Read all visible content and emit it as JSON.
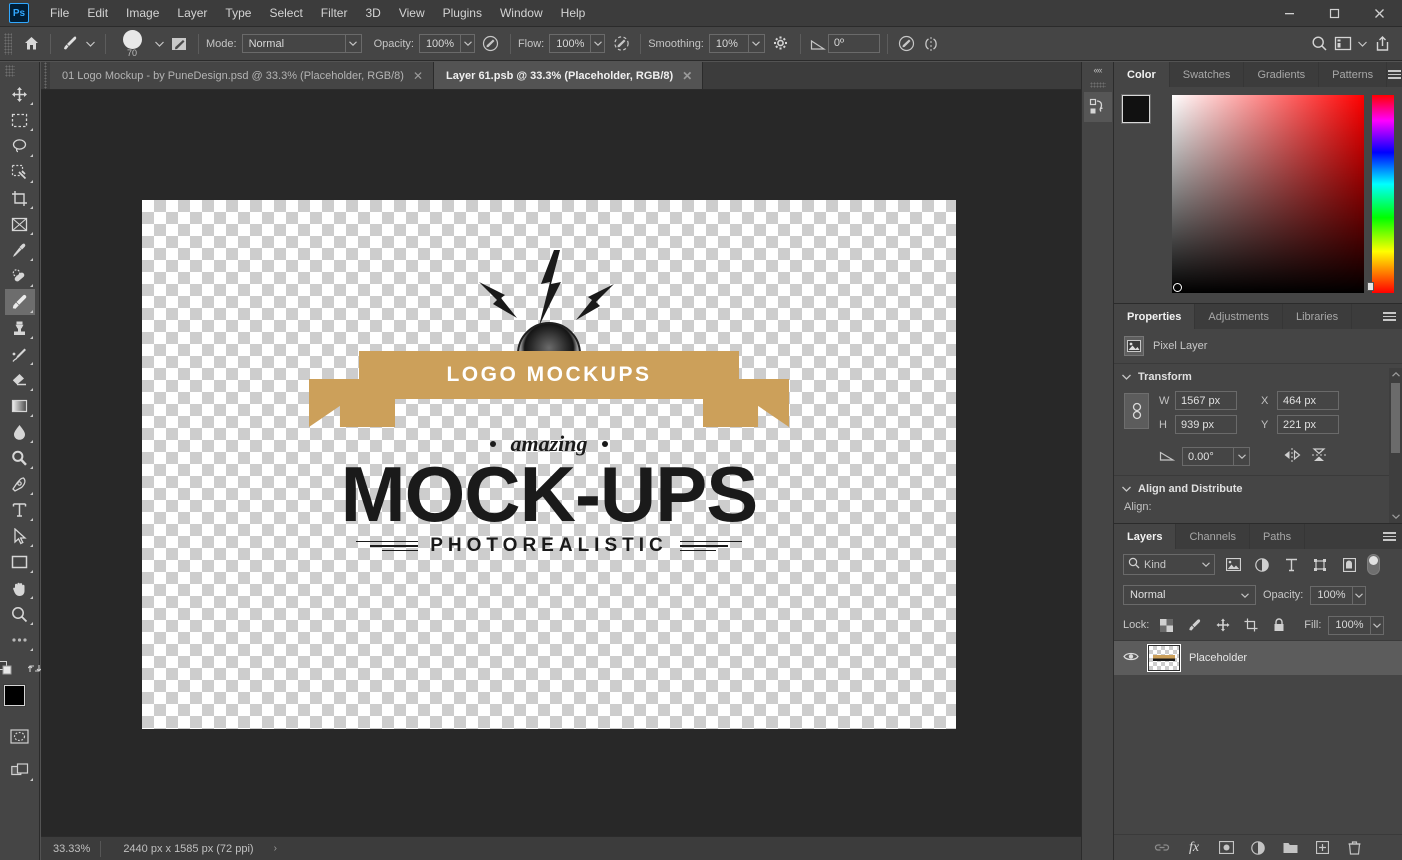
{
  "app": {
    "name": "Ps",
    "logo_label": "Ps"
  },
  "menu": {
    "items": [
      "File",
      "Edit",
      "Image",
      "Layer",
      "Type",
      "Select",
      "Filter",
      "3D",
      "View",
      "Plugins",
      "Window",
      "Help"
    ]
  },
  "window_controls": {
    "minimize": "–",
    "maximize": "□",
    "close": "✕"
  },
  "options_bar": {
    "home_icon": "home-icon",
    "brush_icon": "brush-icon",
    "brush_size": "70",
    "brush_settings_icon": "brush-settings-icon",
    "mode_label": "Mode:",
    "mode_value": "Normal",
    "opacity_label": "Opacity:",
    "opacity_value": "100%",
    "opacity_pressure_icon": "pressure-opacity-icon",
    "flow_label": "Flow:",
    "flow_value": "100%",
    "airbrush_icon": "airbrush-icon",
    "smoothing_label": "Smoothing:",
    "smoothing_value": "10%",
    "smoothing_options_icon": "gear-icon",
    "angle_label": "angle-icon",
    "angle_value": "0º",
    "pressure_size_icon": "pressure-size-icon",
    "symmetry_icon": "symmetry-icon",
    "search_icon": "search-icon",
    "workspace_icon": "workspace-icon",
    "workspace_arrow": "⌄",
    "share_icon": "share-icon"
  },
  "tabs": [
    {
      "title": "01 Logo Mockup - by PuneDesign.psd @ 33.3% (Placeholder, RGB/8)",
      "active": false,
      "close": "✕"
    },
    {
      "title": "Layer 61.psb @ 33.3% (Placeholder, RGB/8)",
      "active": true,
      "close": "✕"
    }
  ],
  "toolbar": {
    "tools": [
      {
        "name": "move-tool",
        "active": false
      },
      {
        "name": "marquee-tool",
        "active": false
      },
      {
        "name": "lasso-tool",
        "active": false
      },
      {
        "name": "quick-selection-tool",
        "active": false
      },
      {
        "name": "crop-tool",
        "active": false
      },
      {
        "name": "frame-tool",
        "active": false
      },
      {
        "name": "eyedropper-tool",
        "active": false
      },
      {
        "name": "healing-brush-tool",
        "active": false
      },
      {
        "name": "brush-tool",
        "active": true
      },
      {
        "name": "clone-stamp-tool",
        "active": false
      },
      {
        "name": "history-brush-tool",
        "active": false
      },
      {
        "name": "eraser-tool",
        "active": false
      },
      {
        "name": "gradient-tool",
        "active": false
      },
      {
        "name": "blur-tool",
        "active": false
      },
      {
        "name": "dodge-tool",
        "active": false
      },
      {
        "name": "pen-tool",
        "active": false
      },
      {
        "name": "type-tool",
        "active": false
      },
      {
        "name": "path-selection-tool",
        "active": false
      },
      {
        "name": "rectangle-tool",
        "active": false
      },
      {
        "name": "hand-tool",
        "active": false
      },
      {
        "name": "zoom-tool",
        "active": false
      },
      {
        "name": "edit-toolbar-tool",
        "active": false
      }
    ],
    "foreground_color": "#000000",
    "background_color": "#ffffff",
    "quick_mask_icon": "quick-mask-icon",
    "screen_mode_icon": "screen-mode-icon"
  },
  "canvas": {
    "logo": {
      "ribbon_text": "LOGO MOCKUPS",
      "script_text": "amazing",
      "headline": "MOCK-UPS",
      "subline": "PHOTOREALISTIC",
      "ribbon_color": "#cca05a",
      "ink_color": "#1a1a1a"
    }
  },
  "status_bar": {
    "zoom": "33.33%",
    "doc_size": "2440 px x 1585 px (72 ppi)",
    "expand_arrow": "›"
  },
  "rail": {
    "collapse_icon": "««",
    "history_icon": "history-icon"
  },
  "color_panel": {
    "tabs": [
      "Color",
      "Swatches",
      "Gradients",
      "Patterns"
    ],
    "active_tab": "Color",
    "foreground_color": "#111111",
    "background_color": "#ffffff",
    "menu_icon": "panel-menu-icon"
  },
  "properties_panel": {
    "tabs": [
      "Properties",
      "Adjustments",
      "Libraries"
    ],
    "active_tab": "Properties",
    "layer_type": "Pixel Layer",
    "layer_type_icon": "pixel-layer-icon",
    "transform": {
      "title": "Transform",
      "link_icon": "link-icon",
      "w_label": "W",
      "w_value": "1567 px",
      "h_label": "H",
      "h_value": "939 px",
      "x_label": "X",
      "x_value": "464 px",
      "y_label": "Y",
      "y_value": "221 px",
      "angle_icon": "angle-icon",
      "angle_value": "0.00°",
      "flip_h_icon": "flip-horizontal-icon",
      "flip_v_icon": "flip-vertical-icon"
    },
    "align": {
      "title": "Align and Distribute",
      "label": "Align:"
    },
    "menu_icon": "panel-menu-icon"
  },
  "layers_panel": {
    "tabs": [
      "Layers",
      "Channels",
      "Paths"
    ],
    "active_tab": "Layers",
    "filter": {
      "search_icon": "search-icon",
      "kind_label": "Kind",
      "arrow": "⌄",
      "icons": [
        "pixel-filter-icon",
        "adjustment-filter-icon",
        "type-filter-icon",
        "shape-filter-icon",
        "smart-object-filter-icon"
      ],
      "toggle": "filter-toggle"
    },
    "blend_mode": "Normal",
    "opacity_label": "Opacity:",
    "opacity_value": "100%",
    "lock_label": "Lock:",
    "lock_icons": [
      "lock-transparency-icon",
      "lock-image-icon",
      "lock-position-icon",
      "lock-artboard-icon",
      "lock-all-icon"
    ],
    "fill_label": "Fill:",
    "fill_value": "100%",
    "layers": [
      {
        "name": "Placeholder",
        "visible": true,
        "selected": true,
        "eye_icon": "eye-icon"
      }
    ],
    "footer_icons": [
      "link-layers-icon",
      "layer-style-icon",
      "layer-mask-icon",
      "adjustment-layer-icon",
      "new-group-icon",
      "new-layer-icon",
      "delete-layer-icon"
    ],
    "footer_fx_label": "fx",
    "menu_icon": "panel-menu-icon"
  }
}
